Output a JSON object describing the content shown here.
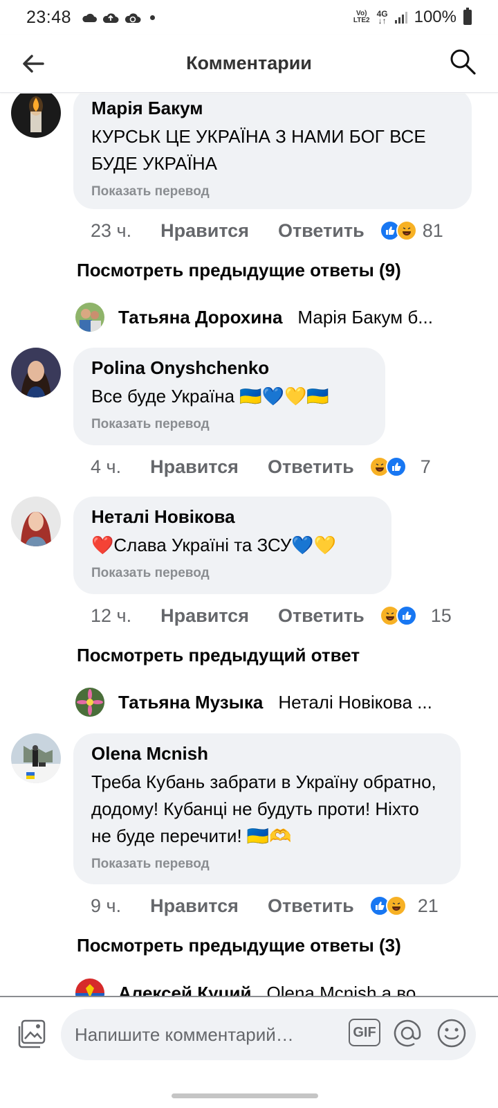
{
  "status_bar": {
    "time": "23:48",
    "left_icons": [
      "cloud-icon",
      "cloud-upload-icon",
      "cloud-sync-icon",
      "dot-icon"
    ],
    "network_top": "Vo)",
    "network_bottom": "LTE2",
    "network_type": "4G",
    "battery": "100%"
  },
  "header": {
    "title": "Комментарии"
  },
  "comments": [
    {
      "author": "Марія Бакум",
      "text": "КУРСЬК ЦЕ УКРАЇНА З НАМИ БОГ ВСЕ БУДЕ УКРАЇНА",
      "translate": "Показать перевод",
      "time": "23 ч.",
      "like": "Нравится",
      "reply": "Ответить",
      "reactions": [
        "like",
        "haha"
      ],
      "count": "81",
      "more_replies": "Посмотреть предыдущие ответы (9)",
      "last_reply": {
        "name": "Татьяна Дорохина",
        "text": "Марія Бакум б..."
      }
    },
    {
      "author": "Polina Onyshchenko",
      "text": "Все буде Україна 🇺🇦💙💛🇺🇦",
      "translate": "Показать перевод",
      "time": "4 ч.",
      "like": "Нравится",
      "reply": "Ответить",
      "reactions": [
        "haha",
        "like"
      ],
      "count": "7"
    },
    {
      "author": "Неталі Новікова",
      "text": "❤️Слава Україні та ЗСУ💙💛",
      "translate": "Показать перевод",
      "time": "12 ч.",
      "like": "Нравится",
      "reply": "Ответить",
      "reactions": [
        "haha",
        "like"
      ],
      "count": "15",
      "more_replies": "Посмотреть предыдущий ответ",
      "last_reply": {
        "name": "Татьяна Музыка",
        "text": "Неталі Новікова ..."
      }
    },
    {
      "author": "Olena Mcnish",
      "text": "Треба Кубань забрати в Україну обратно, додому!  Кубанці не будуть проти! Ніхто не буде перечити! 🇺🇦🫶",
      "translate": "Показать перевод",
      "time": "9 ч.",
      "like": "Нравится",
      "reply": "Ответить",
      "reactions": [
        "like",
        "haha"
      ],
      "count": "21",
      "more_replies": "Посмотреть предыдущие ответы (3)",
      "last_reply": {
        "name": "Алексей Куций",
        "text": "Olena Mcnish а во..."
      }
    }
  ],
  "composer": {
    "placeholder": "Напишите комментарий…",
    "gif_label": "GIF"
  },
  "colors": {
    "accent": "#1877f2",
    "bubble": "#f0f2f5",
    "muted": "#65676b",
    "haha": "#f7b125"
  }
}
